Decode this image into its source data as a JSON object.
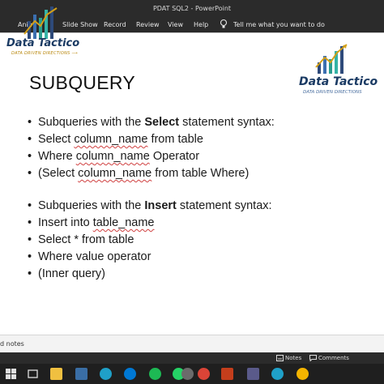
{
  "window": {
    "doc_title": "PDAT SQL2 - PowerPoint"
  },
  "ribbon": {
    "tabs": [
      "Anim",
      "Slide Show",
      "Record",
      "Review",
      "View",
      "Help"
    ],
    "tell_me": "Tell me what you want to do"
  },
  "watermark": {
    "brand": "Data Tactico",
    "tagline": "DATA DRIVEN DIRECTIONS"
  },
  "slide": {
    "title": "SUBQUERY",
    "logo_brand": "Data Tactico",
    "logo_tagline": "DATA DRIVEN DIRECTIONS",
    "select_section": {
      "intro_before": "Subqueries with the ",
      "intro_bold": "Select",
      "intro_after": " statement syntax:",
      "line2_a": "Select ",
      "line2_b": "column_name",
      "line2_c": " from table",
      "line3_a": "Where ",
      "line3_b": "column_name",
      "line3_c": " Operator",
      "line4_a": "(Select ",
      "line4_b": "column_name",
      "line4_c": " from table Where)"
    },
    "insert_section": {
      "intro_before": "Subqueries with the ",
      "intro_bold": "Insert",
      "intro_after": " statement syntax:",
      "line2_a": "Insert into ",
      "line2_b": "table_name",
      "line3": "Select * from table",
      "line4": "Where value operator",
      "line5": "(Inner query)"
    },
    "bullet": "•"
  },
  "notes_bar": {
    "label": "d notes"
  },
  "statusbar": {
    "notes": "Notes",
    "comments": "Comments"
  },
  "taskbar": {
    "icons": [
      "start-icon",
      "search-icon",
      "task-view-icon",
      "file-explorer-icon",
      "app-icon",
      "edge-icon",
      "skype-icon",
      "spotify-icon",
      "whatsapp-icon",
      "settings-icon",
      "chrome-icon",
      "powerpoint-icon",
      "app-icon-2",
      "edge-icon-2",
      "chrome-icon-2"
    ]
  },
  "colors": {
    "brand_blue": "#1a3a63",
    "tagline_gold": "#b8860b",
    "chrome_dark": "#2b2b2b",
    "spellcheck_red": "#d04040"
  }
}
